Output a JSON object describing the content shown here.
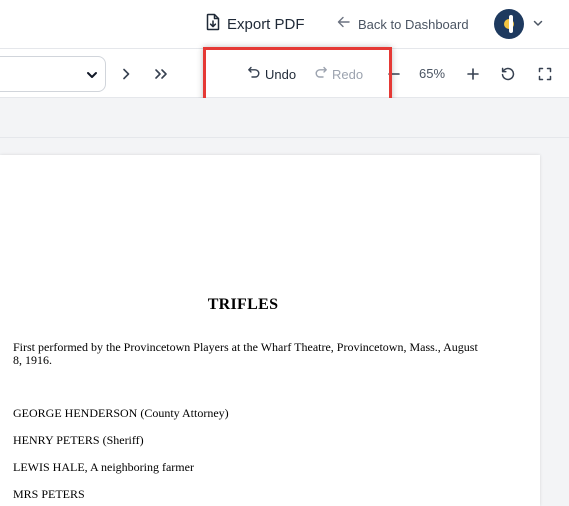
{
  "header": {
    "export_label": "Export PDF",
    "back_label": "Back to Dashboard",
    "avatar_colors": {
      "bg": "#1e3a5f",
      "accent": "#f4c542"
    }
  },
  "toolbar": {
    "undo_label": "Undo",
    "redo_label": "Redo",
    "zoom_level": "65%",
    "icons": [
      "next-page-icon",
      "last-page-icon",
      "undo-icon",
      "redo-icon",
      "zoom-out-icon",
      "zoom-in-icon",
      "reset-icon",
      "fullscreen-icon"
    ],
    "highlight_color": "#e53935"
  },
  "document": {
    "title": "TRIFLES",
    "lines": [
      "First performed by the Provincetown Players at the Wharf Theatre, Provincetown, Mass., August",
      " 8, 1916.",
      "GEORGE HENDERSON (County Attorney)",
      "HENRY PETERS (Sheriff)",
      "LEWIS HALE, A neighboring farmer",
      "MRS PETERS"
    ]
  }
}
